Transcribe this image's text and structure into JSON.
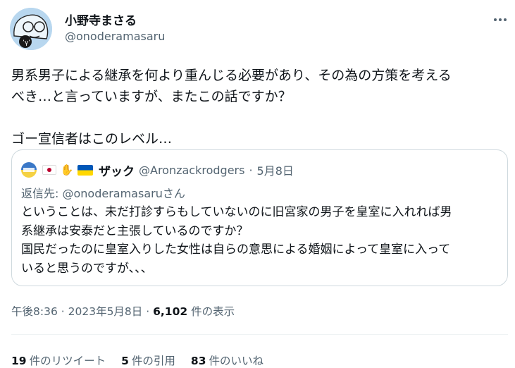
{
  "author": {
    "display_name": "小野寺まさる",
    "handle": "@onoderamasaru",
    "avatar_icon": "caricature-avatar-icon"
  },
  "more_icon": "ellipsis-icon",
  "tweet": {
    "text": "男系男子による継承を何より重んじる必要があり、その為の方策を考える\nべき…と言っていますが、またこの話ですか？\n\nゴー宣信者はこのレベル…"
  },
  "quote": {
    "avatar_icon": "stand-with-ukraine-avatar-icon",
    "name_emojis": [
      "japan-flag-icon",
      "handshake-icon",
      "ukraine-flag-icon"
    ],
    "name": "ザック",
    "handle": "@Aronzackrodgers",
    "separator": "·",
    "date": "5月8日",
    "reply_prefix": "返信先: ",
    "reply_to": "@onoderamasaru",
    "reply_suffix": "さん",
    "text": "ということは、未だ打診すらもしていないのに旧宮家の男子を皇室に入れれば男\n系継承は安泰だと主張しているのですか？\n国民だったのに皇室入りした女性は自らの意思による婚姻によって皇室に入って\nいると思うのですが、、、"
  },
  "meta": {
    "time": "午後8:36",
    "separator": "·",
    "date": "2023年5月8日",
    "views_count": "6,102",
    "views_label": "件の表示"
  },
  "stats": {
    "retweets_count": "19",
    "retweets_label": "件のリツイート",
    "quotes_count": "5",
    "quotes_label": "件の引用",
    "likes_count": "83",
    "likes_label": "件のいいね"
  },
  "colors": {
    "text_primary": "#0f1419",
    "text_secondary": "#536471",
    "border": "#cfd9de"
  }
}
